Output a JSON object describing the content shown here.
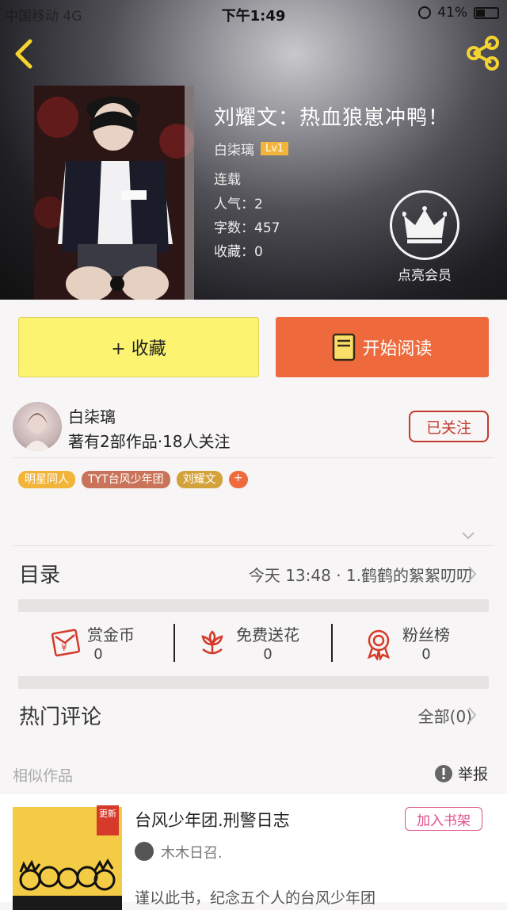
{
  "status_bar": {
    "carrier": "中国移动  4G",
    "time": "下午1:49",
    "battery": "41%",
    "battery_level": 0.41
  },
  "header": {
    "title": "刘耀文：热血狼崽冲鸭！",
    "author": "白柒璃",
    "level": "Lv1",
    "status": "连载",
    "popularity": "人气：2",
    "word_count": "字数：457",
    "favorites": "收藏：0",
    "vip_label": "点亮会员"
  },
  "actions": {
    "favorite": "+ 收藏",
    "read": "开始阅读"
  },
  "author_card": {
    "name": "白柒璃",
    "stats": "著有2部作品·18人关注",
    "follow": "已关注"
  },
  "tags": [
    {
      "label": "明星同人",
      "color": "#f2b53a"
    },
    {
      "label": "TYT台风少年团",
      "color": "#c9745a"
    },
    {
      "label": "刘耀文",
      "color": "#d4a23a"
    }
  ],
  "tag_plus": "+",
  "catalog": {
    "label": "目录",
    "latest": "今天 13:48 · 1.鹤鹤的絮絮叨叨"
  },
  "stats": [
    {
      "label": "赏金币",
      "value": "0"
    },
    {
      "label": "免费送花",
      "value": "0"
    },
    {
      "label": "粉丝榜",
      "value": "0"
    }
  ],
  "comments": {
    "label": "热门评论",
    "all": "全部(0)"
  },
  "similar": {
    "label": "相似作品",
    "report": "举报",
    "book": {
      "new_badge": "更新",
      "title": "台风少年团.刑警日志",
      "shelf": "加入书架",
      "author": "木木日召.",
      "desc": "谨以此书，纪念五个人的台风少年团"
    }
  },
  "colors": {
    "accent": "#ee6a3c",
    "fav_bg": "#fcf471",
    "follow": "#c23a2e",
    "icon_red": "#d63a2a",
    "share_yellow": "#f5d430"
  }
}
